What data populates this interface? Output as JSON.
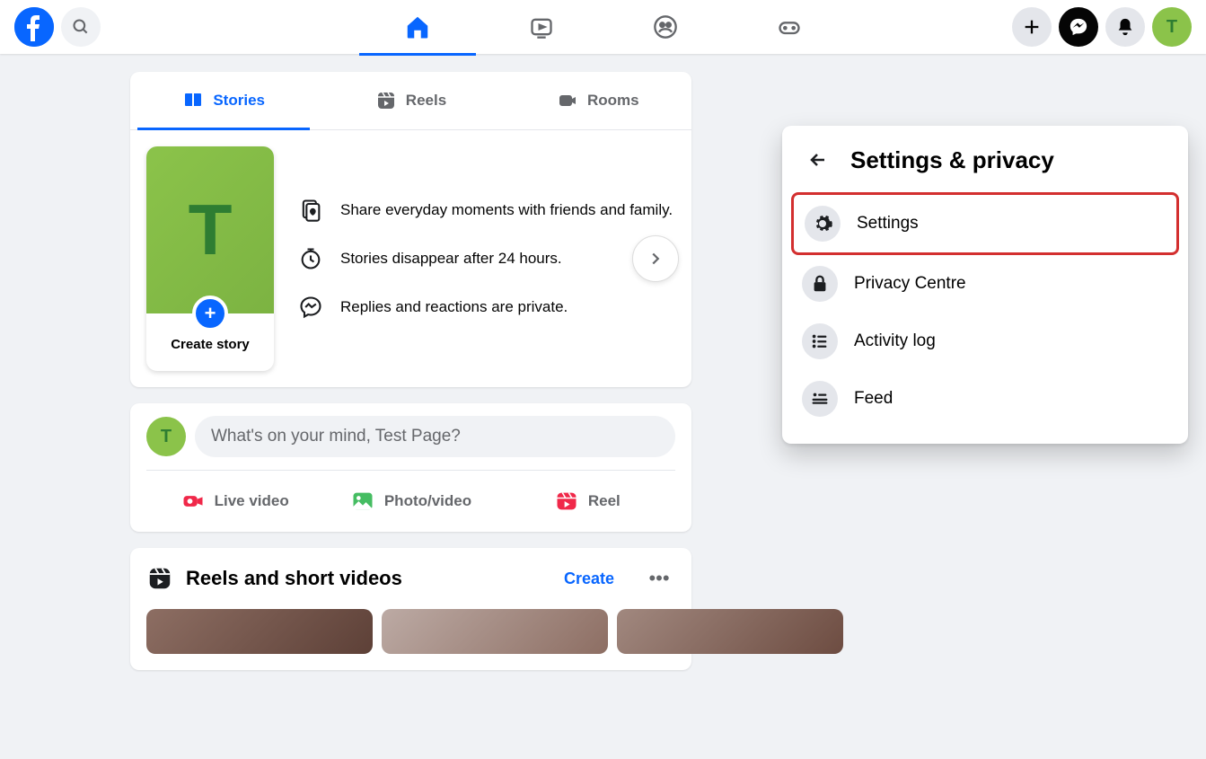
{
  "user": {
    "initial": "T"
  },
  "stories_card": {
    "tabs": [
      {
        "label": "Stories"
      },
      {
        "label": "Reels"
      },
      {
        "label": "Rooms"
      }
    ],
    "create_label": "Create story",
    "info": [
      "Share everyday moments with friends and family.",
      "Stories disappear after 24 hours.",
      "Replies and reactions are private."
    ]
  },
  "composer": {
    "placeholder": "What's on your mind, Test Page?",
    "actions": [
      {
        "label": "Live video"
      },
      {
        "label": "Photo/video"
      },
      {
        "label": "Reel"
      }
    ]
  },
  "reels": {
    "title": "Reels and short videos",
    "create_label": "Create"
  },
  "dropdown": {
    "title": "Settings & privacy",
    "items": [
      {
        "label": "Settings"
      },
      {
        "label": "Privacy Centre"
      },
      {
        "label": "Activity log"
      },
      {
        "label": "Feed"
      }
    ]
  }
}
